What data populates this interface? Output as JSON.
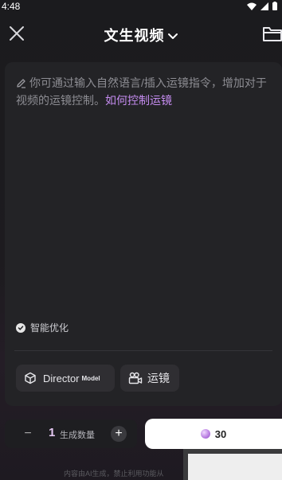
{
  "status_bar": {
    "time": "4:48"
  },
  "header": {
    "title": "文生视频"
  },
  "prompt": {
    "placeholder": "你可通过输入自然语言/插入运镜指令，增加对于视频的运镜控制。",
    "link": "如何控制运镜"
  },
  "smart_optimize": {
    "label": "智能优化",
    "checked": true
  },
  "chips": {
    "director_label": "Director",
    "director_badge": "Model",
    "camera_label": "运镜"
  },
  "stepper": {
    "value": "1",
    "label": "生成数量",
    "minus": "−",
    "plus": "+"
  },
  "generate": {
    "cost": "30"
  },
  "disclaimer": "内容由AI生成，禁止利用功能从",
  "colors": {
    "accent": "#c58cf0",
    "background": "#1b1b1e",
    "card": "#232326"
  }
}
